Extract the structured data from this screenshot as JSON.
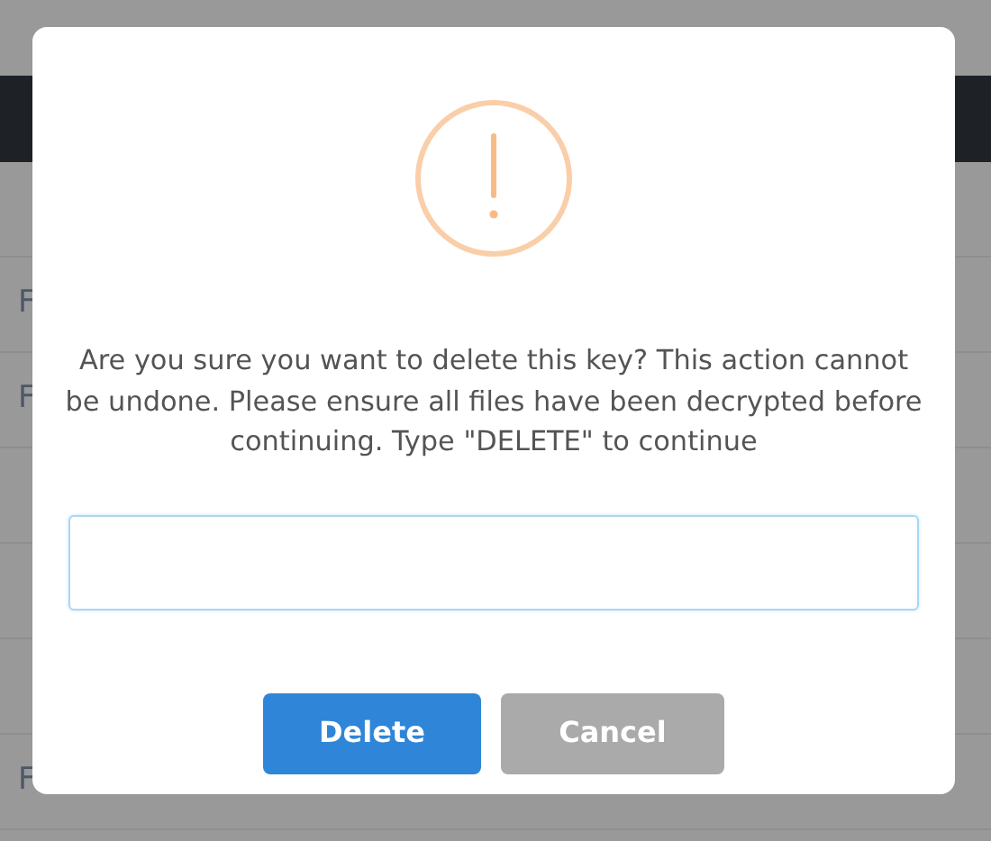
{
  "background_table": {
    "rows": [
      {
        "cell": null
      },
      {
        "cell": "F"
      },
      {
        "cell": "F"
      },
      {
        "cell": null
      },
      {
        "cell": null
      },
      {
        "cell": null
      },
      {
        "cell": "F"
      }
    ]
  },
  "dialog": {
    "message": "Are you sure you want to delete this key? This action cannot be undone. Please ensure all files have been decrypted before continuing. Type \"DELETE\" to continue",
    "buttons": [
      {
        "label": "Delete",
        "kind": "primary"
      },
      {
        "label": "Cancel",
        "kind": "secondary"
      }
    ]
  }
}
